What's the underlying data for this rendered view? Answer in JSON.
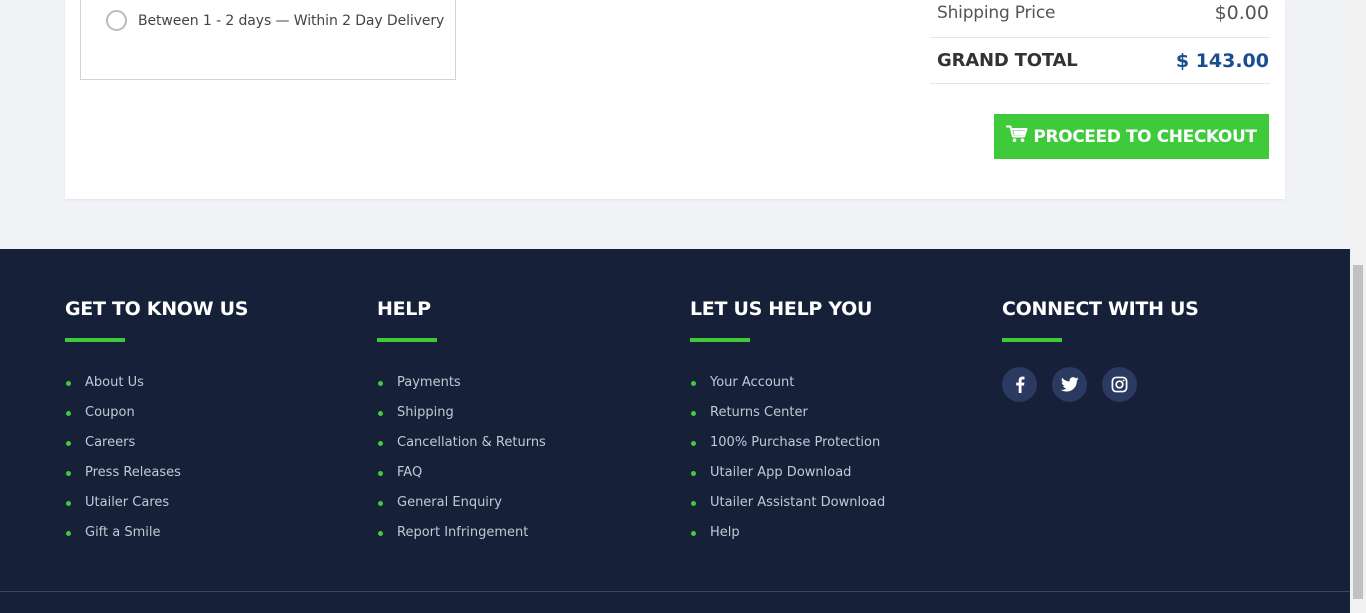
{
  "shipping_option": {
    "label": "Between 1 - 2 days — Within 2 Day Delivery",
    "selected": false
  },
  "summary": {
    "shipping_label": "Shipping Price",
    "shipping_value": "$0.00",
    "total_label": "GRAND TOTAL",
    "total_value": "$ 143.00"
  },
  "checkout": {
    "label": "PROCEED TO CHECKOUT",
    "icon": "cart-icon"
  },
  "footer": {
    "columns": [
      {
        "title": "GET TO KNOW US",
        "items": [
          "About Us",
          "Coupon",
          "Careers",
          "Press Releases",
          "Utailer Cares",
          "Gift a Smile"
        ]
      },
      {
        "title": "HELP",
        "items": [
          "Payments",
          "Shipping",
          "Cancellation & Returns",
          "FAQ",
          "General Enquiry",
          "Report Infringement"
        ]
      },
      {
        "title": "LET US HELP YOU",
        "items": [
          "Your Account",
          "Returns Center",
          "100% Purchase Protection",
          "Utailer App Download",
          "Utailer Assistant Download",
          "Help"
        ]
      },
      {
        "title": "CONNECT WITH US",
        "social": [
          "facebook-icon",
          "twitter-icon",
          "instagram-icon"
        ]
      }
    ]
  },
  "colors": {
    "accent_green": "#3fca3c",
    "footer_bg": "#162039",
    "total_blue": "#1a4f8f",
    "social_bg": "#2a3a61"
  }
}
